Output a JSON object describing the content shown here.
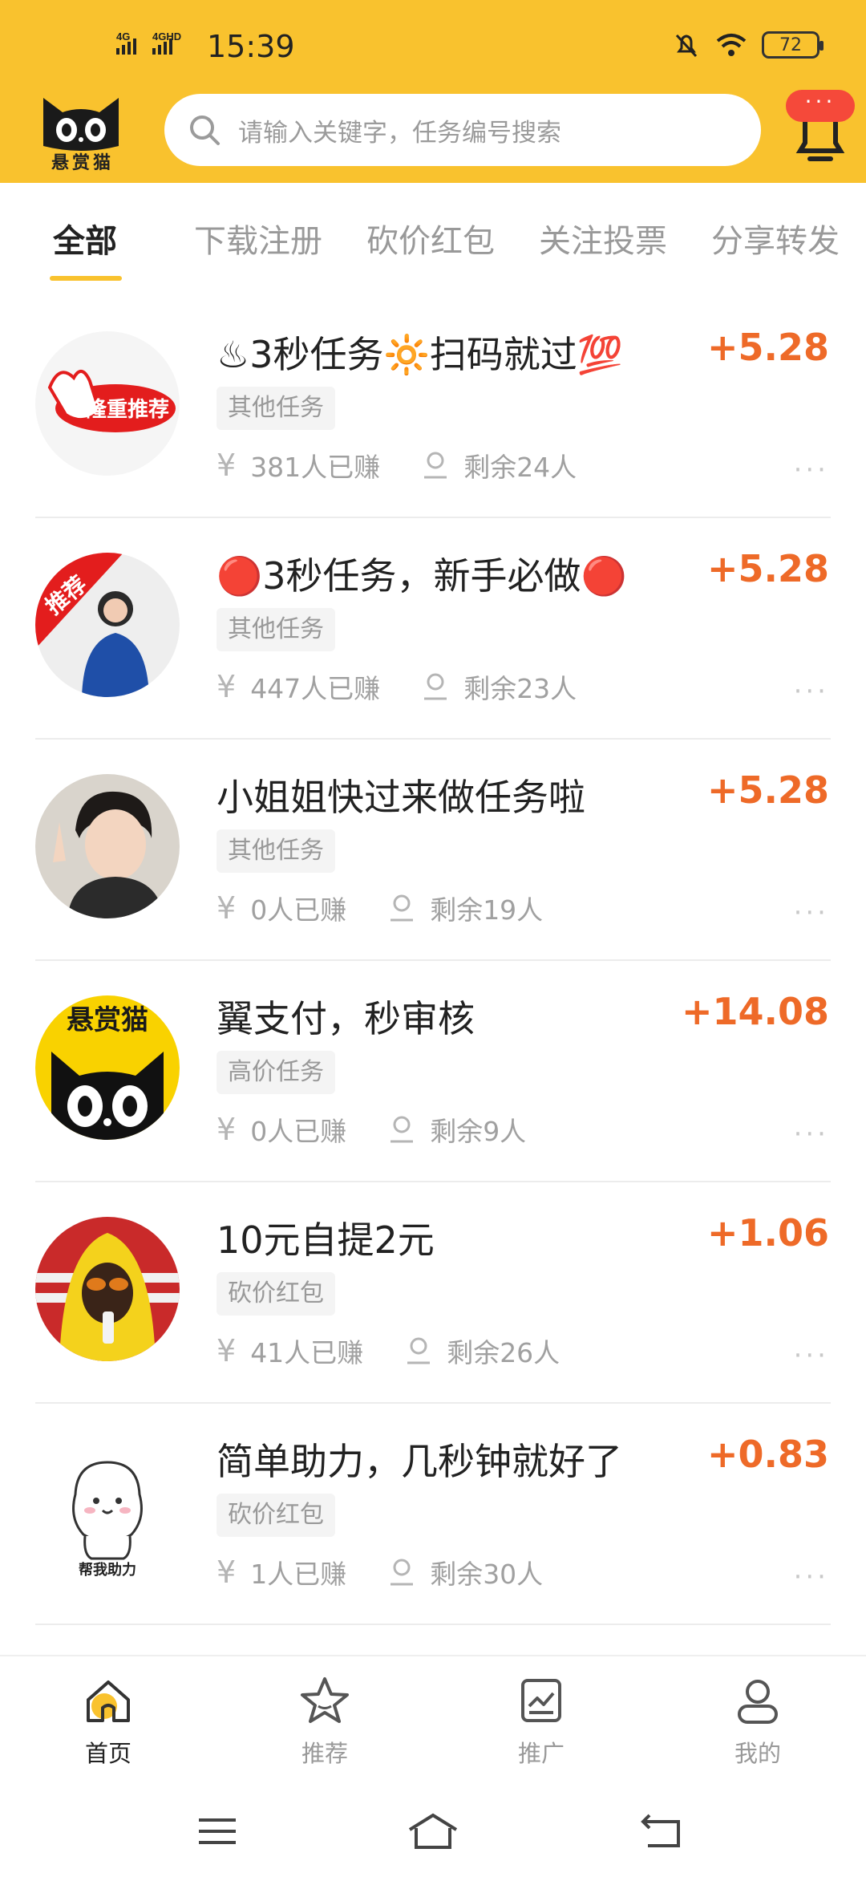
{
  "status_bar": {
    "network_1": "4G",
    "network_2": "4GHD",
    "time": "15:39",
    "battery": "72"
  },
  "header": {
    "logo_face": "0.0",
    "logo_text": "悬赏猫",
    "search_placeholder": "请输入关键字，任务编号搜索",
    "bell_badge": "···"
  },
  "tabs": [
    {
      "label": "全部",
      "active": true
    },
    {
      "label": "下载注册"
    },
    {
      "label": "砍价红包"
    },
    {
      "label": "关注投票"
    },
    {
      "label": "分享转发"
    }
  ],
  "tasks": [
    {
      "title": "♨3秒任务🔆扫码就过💯",
      "reward": "+5.28",
      "tag": "其他任务",
      "earned": "381人已赚",
      "remaining": "剩余24人",
      "avatar_text": "隆重推荐"
    },
    {
      "title": "🔴3秒任务，新手必做🔴",
      "reward": "+5.28",
      "tag": "其他任务",
      "earned": "447人已赚",
      "remaining": "剩余23人",
      "avatar_text": "推荐"
    },
    {
      "title": "小姐姐快过来做任务啦",
      "reward": "+5.28",
      "tag": "其他任务",
      "earned": "0人已赚",
      "remaining": "剩余19人",
      "avatar_text": ""
    },
    {
      "title": "翼支付，秒审核",
      "reward": "+14.08",
      "tag": "高价任务",
      "earned": "0人已赚",
      "remaining": "剩余9人",
      "avatar_text": "悬赏猫"
    },
    {
      "title": "10元自提2元",
      "reward": "+1.06",
      "tag": "砍价红包",
      "earned": "41人已赚",
      "remaining": "剩余26人",
      "avatar_text": ""
    },
    {
      "title": "简单助力，几秒钟就好了",
      "reward": "+0.83",
      "tag": "砍价红包",
      "earned": "1人已赚",
      "remaining": "剩余30人",
      "avatar_text": "帮我助力"
    }
  ],
  "currency_symbol": "¥",
  "more_label": "···",
  "bottom_nav": [
    {
      "label": "首页",
      "icon": "home-icon",
      "active": true
    },
    {
      "label": "推荐",
      "icon": "star-icon"
    },
    {
      "label": "推广",
      "icon": "chart-icon"
    },
    {
      "label": "我的",
      "icon": "profile-icon"
    }
  ],
  "colors": {
    "brand_yellow": "#F9C22E",
    "reward_orange": "#EE6A28",
    "badge_red": "#F5493A"
  }
}
